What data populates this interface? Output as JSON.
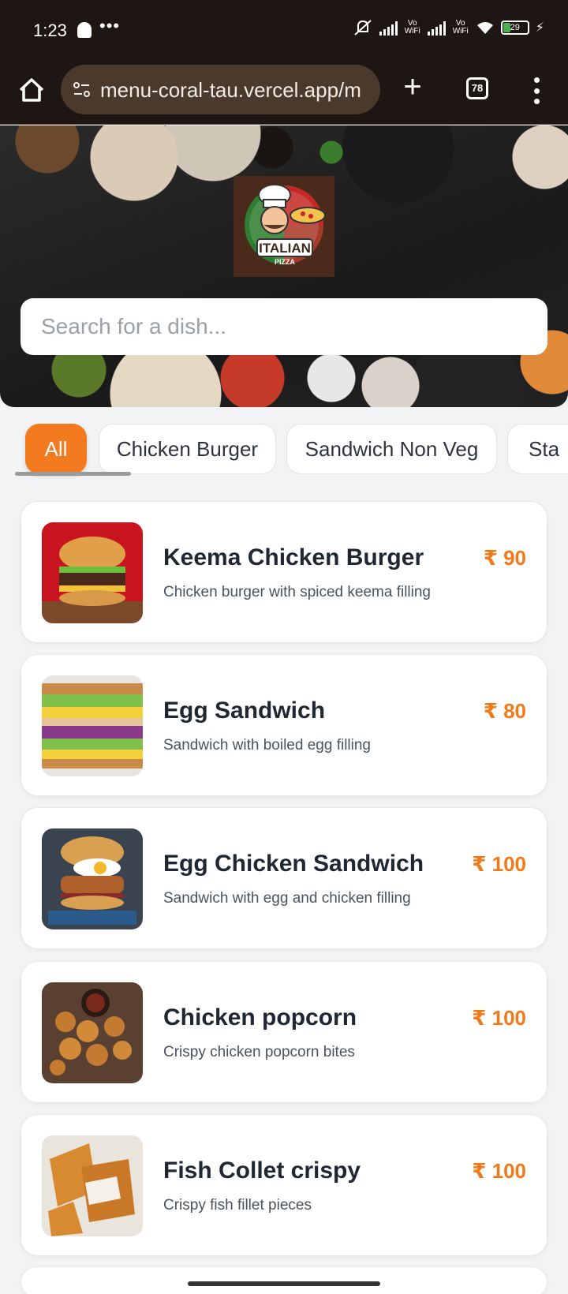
{
  "status_bar": {
    "time": "1:23",
    "dots": "•••",
    "vowifi_1": "Vo WiFi",
    "vowifi_2": "Vo WiFi",
    "battery": "29",
    "icons": [
      "snapchat-icon",
      "mute-icon",
      "signal-icon",
      "wifi-icon",
      "battery-icon",
      "charging-icon"
    ]
  },
  "browser": {
    "url": "menu-coral-tau.vercel.app/m",
    "tab_count": "78",
    "new_tab_glyph": "+",
    "icons": [
      "home-icon",
      "site-settings-icon",
      "plus-icon",
      "tabs-icon",
      "more-vert-icon"
    ]
  },
  "hero": {
    "logo_text": "ITALIAN",
    "logo_subtext": "PIZZA",
    "search_placeholder": "Search for a dish..."
  },
  "categories": [
    {
      "label": "All",
      "active": true
    },
    {
      "label": "Chicken Burger",
      "active": false
    },
    {
      "label": "Sandwich Non Veg",
      "active": false
    },
    {
      "label": "Sta",
      "active": false
    }
  ],
  "items": [
    {
      "name": "Keema Chicken Burger",
      "description": "Chicken burger with spiced keema filling",
      "price": "₹ 90"
    },
    {
      "name": "Egg Sandwich",
      "description": "Sandwich with boiled egg filling",
      "price": "₹ 80"
    },
    {
      "name": "Egg Chicken Sandwich",
      "description": "Sandwich with egg and chicken filling",
      "price": "₹ 100"
    },
    {
      "name": "Chicken popcorn",
      "description": "Crispy chicken popcorn bites",
      "price": "₹ 100"
    },
    {
      "name": "Fish Collet crispy",
      "description": "Crispy fish fillet pieces",
      "price": "₹ 100"
    }
  ],
  "colors": {
    "accent": "#f47a1f",
    "price": "#f07a1a",
    "browser_bg": "#1e1612",
    "urlbar_bg": "#4a3a2e"
  }
}
